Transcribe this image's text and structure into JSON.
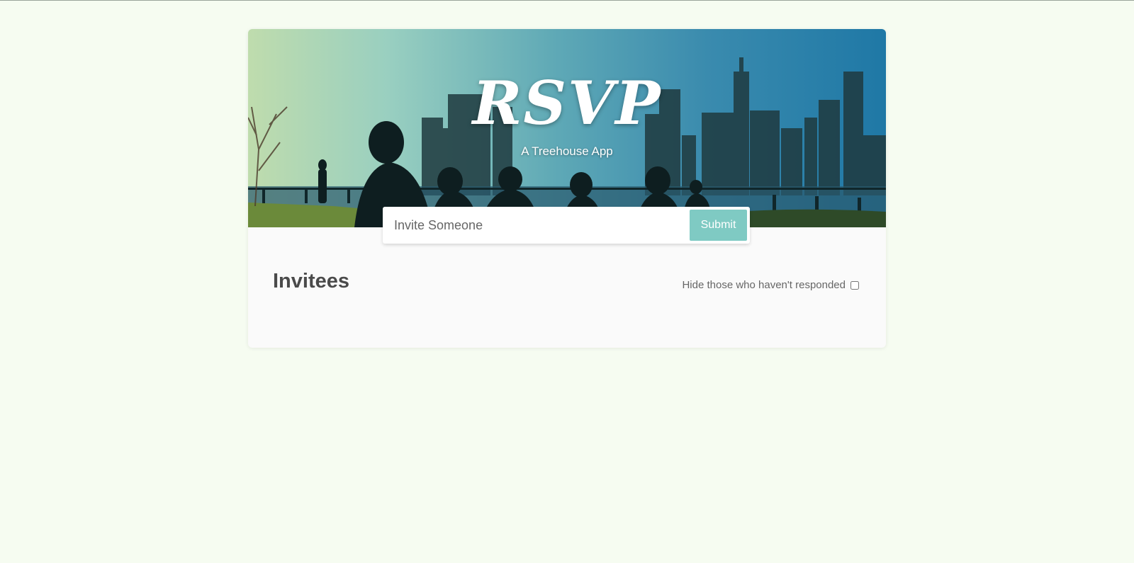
{
  "header": {
    "title": "RSVP",
    "subtitle": "A Treehouse App"
  },
  "invite_form": {
    "placeholder": "Invite Someone",
    "value": "",
    "submit_label": "Submit"
  },
  "main": {
    "heading": "Invitees",
    "filter_label": "Hide those who haven't responded",
    "filter_checked": false,
    "invitees": []
  },
  "colors": {
    "page_background": "#f6fcf1",
    "card_background": "#fafafa",
    "accent": "#7fcac3",
    "heading_text": "#4a4a4a"
  }
}
